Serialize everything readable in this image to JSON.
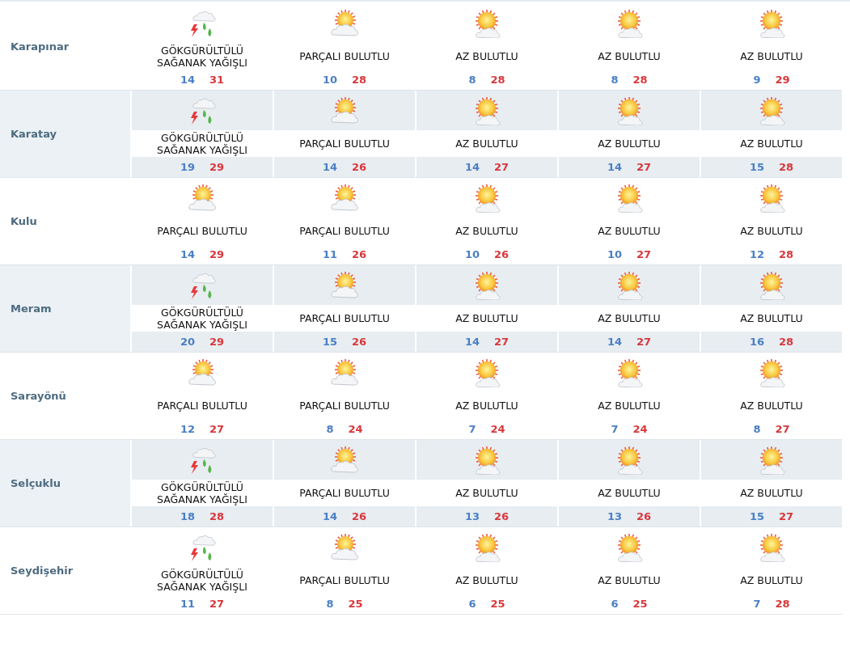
{
  "cities": [
    {
      "name": "Karapınar",
      "days": [
        {
          "kind": "storm",
          "condition": "GÖKGÜRÜLTÜLÜ SAĞANAK YAĞIŞLI",
          "low": "14",
          "high": "31"
        },
        {
          "kind": "partly_cloudy",
          "condition": "PARÇALI BULUTLU",
          "low": "10",
          "high": "28"
        },
        {
          "kind": "mostly_sunny",
          "condition": "AZ BULUTLU",
          "low": "8",
          "high": "28"
        },
        {
          "kind": "mostly_sunny",
          "condition": "AZ BULUTLU",
          "low": "8",
          "high": "28"
        },
        {
          "kind": "mostly_sunny",
          "condition": "AZ BULUTLU",
          "low": "9",
          "high": "29"
        }
      ]
    },
    {
      "name": "Karatay",
      "days": [
        {
          "kind": "storm",
          "condition": "GÖKGÜRÜLTÜLÜ SAĞANAK YAĞIŞLI",
          "low": "19",
          "high": "29"
        },
        {
          "kind": "partly_cloudy",
          "condition": "PARÇALI BULUTLU",
          "low": "14",
          "high": "26"
        },
        {
          "kind": "mostly_sunny",
          "condition": "AZ BULUTLU",
          "low": "14",
          "high": "27"
        },
        {
          "kind": "mostly_sunny",
          "condition": "AZ BULUTLU",
          "low": "14",
          "high": "27"
        },
        {
          "kind": "mostly_sunny",
          "condition": "AZ BULUTLU",
          "low": "15",
          "high": "28"
        }
      ]
    },
    {
      "name": "Kulu",
      "days": [
        {
          "kind": "partly_cloudy",
          "condition": "PARÇALI BULUTLU",
          "low": "14",
          "high": "29"
        },
        {
          "kind": "partly_cloudy",
          "condition": "PARÇALI BULUTLU",
          "low": "11",
          "high": "26"
        },
        {
          "kind": "mostly_sunny",
          "condition": "AZ BULUTLU",
          "low": "10",
          "high": "26"
        },
        {
          "kind": "mostly_sunny",
          "condition": "AZ BULUTLU",
          "low": "10",
          "high": "27"
        },
        {
          "kind": "mostly_sunny",
          "condition": "AZ BULUTLU",
          "low": "12",
          "high": "28"
        }
      ]
    },
    {
      "name": "Meram",
      "days": [
        {
          "kind": "storm",
          "condition": "GÖKGÜRÜLTÜLÜ SAĞANAK YAĞIŞLI",
          "low": "20",
          "high": "29"
        },
        {
          "kind": "partly_cloudy",
          "condition": "PARÇALI BULUTLU",
          "low": "15",
          "high": "26"
        },
        {
          "kind": "mostly_sunny",
          "condition": "AZ BULUTLU",
          "low": "14",
          "high": "27"
        },
        {
          "kind": "mostly_sunny",
          "condition": "AZ BULUTLU",
          "low": "14",
          "high": "27"
        },
        {
          "kind": "mostly_sunny",
          "condition": "AZ BULUTLU",
          "low": "16",
          "high": "28"
        }
      ]
    },
    {
      "name": "Sarayönü",
      "days": [
        {
          "kind": "partly_cloudy",
          "condition": "PARÇALI BULUTLU",
          "low": "12",
          "high": "27"
        },
        {
          "kind": "partly_cloudy",
          "condition": "PARÇALI BULUTLU",
          "low": "8",
          "high": "24"
        },
        {
          "kind": "mostly_sunny",
          "condition": "AZ BULUTLU",
          "low": "7",
          "high": "24"
        },
        {
          "kind": "mostly_sunny",
          "condition": "AZ BULUTLU",
          "low": "7",
          "high": "24"
        },
        {
          "kind": "mostly_sunny",
          "condition": "AZ BULUTLU",
          "low": "8",
          "high": "27"
        }
      ]
    },
    {
      "name": "Selçuklu",
      "days": [
        {
          "kind": "storm",
          "condition": "GÖKGÜRÜLTÜLÜ SAĞANAK YAĞIŞLI",
          "low": "18",
          "high": "28"
        },
        {
          "kind": "partly_cloudy",
          "condition": "PARÇALI BULUTLU",
          "low": "14",
          "high": "26"
        },
        {
          "kind": "mostly_sunny",
          "condition": "AZ BULUTLU",
          "low": "13",
          "high": "26"
        },
        {
          "kind": "mostly_sunny",
          "condition": "AZ BULUTLU",
          "low": "13",
          "high": "26"
        },
        {
          "kind": "mostly_sunny",
          "condition": "AZ BULUTLU",
          "low": "15",
          "high": "27"
        }
      ]
    },
    {
      "name": "Seydişehir",
      "days": [
        {
          "kind": "storm",
          "condition": "GÖKGÜRÜLTÜLÜ SAĞANAK YAĞIŞLI",
          "low": "11",
          "high": "27"
        },
        {
          "kind": "partly_cloudy",
          "condition": "PARÇALI BULUTLU",
          "low": "8",
          "high": "25"
        },
        {
          "kind": "mostly_sunny",
          "condition": "AZ BULUTLU",
          "low": "6",
          "high": "25"
        },
        {
          "kind": "mostly_sunny",
          "condition": "AZ BULUTLU",
          "low": "6",
          "high": "25"
        },
        {
          "kind": "mostly_sunny",
          "condition": "AZ BULUTLU",
          "low": "7",
          "high": "28"
        }
      ]
    }
  ]
}
